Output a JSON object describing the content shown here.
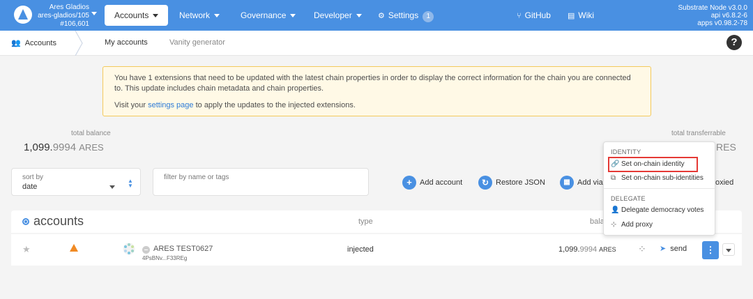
{
  "header": {
    "chain_name": "Ares Gladios",
    "chain_id": "ares-gladios/105",
    "block": "#106,601",
    "nav": {
      "accounts": "Accounts",
      "network": "Network",
      "governance": "Governance",
      "developer": "Developer",
      "settings": "Settings",
      "settings_badge": "1",
      "github": "GitHub",
      "wiki": "Wiki"
    },
    "version": {
      "node": "Substrate Node v3.0.0",
      "api": "api v6.8.2-6",
      "apps": "apps v0.98.2-78"
    }
  },
  "subnav": {
    "section": "Accounts",
    "tabs": [
      "My accounts",
      "Vanity generator"
    ]
  },
  "warning": {
    "line1": "You have 1 extensions that need to be updated with the latest chain properties in order to display the correct information for the chain you are connected to. This update includes chain metadata and chain properties.",
    "line2_pre": "Visit your ",
    "link": "settings page",
    "line2_post": " to apply the updates to the injected extensions."
  },
  "summary": {
    "total_balance_label": "total balance",
    "total_balance_int": "1,099.",
    "total_balance_dec": "9994",
    "total_balance_unit": "ARES",
    "transferrable_label": "total transferrable",
    "transferrable_tail": "RES"
  },
  "controls": {
    "sort_label": "sort by",
    "sort_value": "date",
    "filter_placeholder": "filter by name or tags",
    "add_account": "Add account",
    "restore_json": "Restore JSON",
    "add_via": "Add via",
    "proxied_tail": "oxied"
  },
  "table": {
    "title": "accounts",
    "col_type": "type",
    "col_balance": "bala",
    "rows": [
      {
        "name": "ARES TEST0627",
        "address": "4PsBNv...F33REg",
        "type": "injected",
        "balance_int": "1,099.",
        "balance_dec": "9994",
        "unit": "ARES",
        "send": "send"
      }
    ]
  },
  "menu": {
    "identity_header": "IDENTITY",
    "set_identity": "Set on-chain identity",
    "set_sub_identities": "Set on-chain sub-identities",
    "delegate_header": "DELEGATE",
    "delegate_votes": "Delegate democracy votes",
    "add_proxy": "Add proxy"
  },
  "colors": {
    "header_bg": "#4990e2",
    "warning_bg": "#fff9e6",
    "warning_border": "#f3c95c",
    "highlight_border": "#e53935",
    "link": "#2e7bd6"
  }
}
